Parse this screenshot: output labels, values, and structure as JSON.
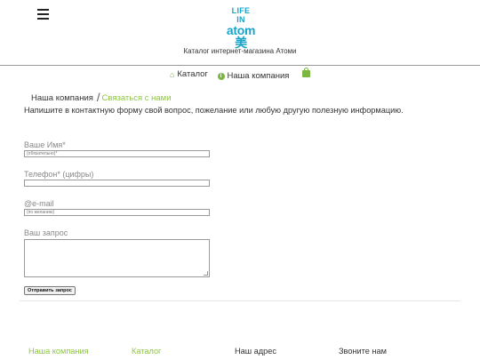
{
  "header": {
    "menu_icon": "hamburger-menu-icon",
    "logo": {
      "line1": "LIFE",
      "line2": "IN",
      "line3": "atom美"
    },
    "tagline": "Каталог интернет-магазина Атоми"
  },
  "nav": {
    "catalog_label": "Каталог",
    "catalog_icon": "home-icon",
    "company_label": "Наша компания",
    "company_icon": "info-icon",
    "cart_icon": "shopping-bag-icon"
  },
  "breadcrumb": {
    "parent": "Наша компания",
    "separator": "/",
    "current": "Связаться с нами"
  },
  "intro": "Напишите в контактную форму свой вопрос, пожелание или любую другую полезную информацию.",
  "form": {
    "name_label": "Ваше Имя*",
    "name_placeholder": "(обязательно)*",
    "phone_label": "Телефон* (цифры)",
    "phone_placeholder": "",
    "email_label": "@e-mail",
    "email_placeholder": "(по желанию)",
    "request_label": "Ваш запрос",
    "submit_label": "Отправить запрос"
  },
  "footer": {
    "col1": "Наша компания",
    "col2": "Каталог",
    "col3": "Наш адрес",
    "col4": "Звоните нам"
  },
  "colors": {
    "accent": "#8cc63f",
    "logo": "#1aa3c8"
  }
}
